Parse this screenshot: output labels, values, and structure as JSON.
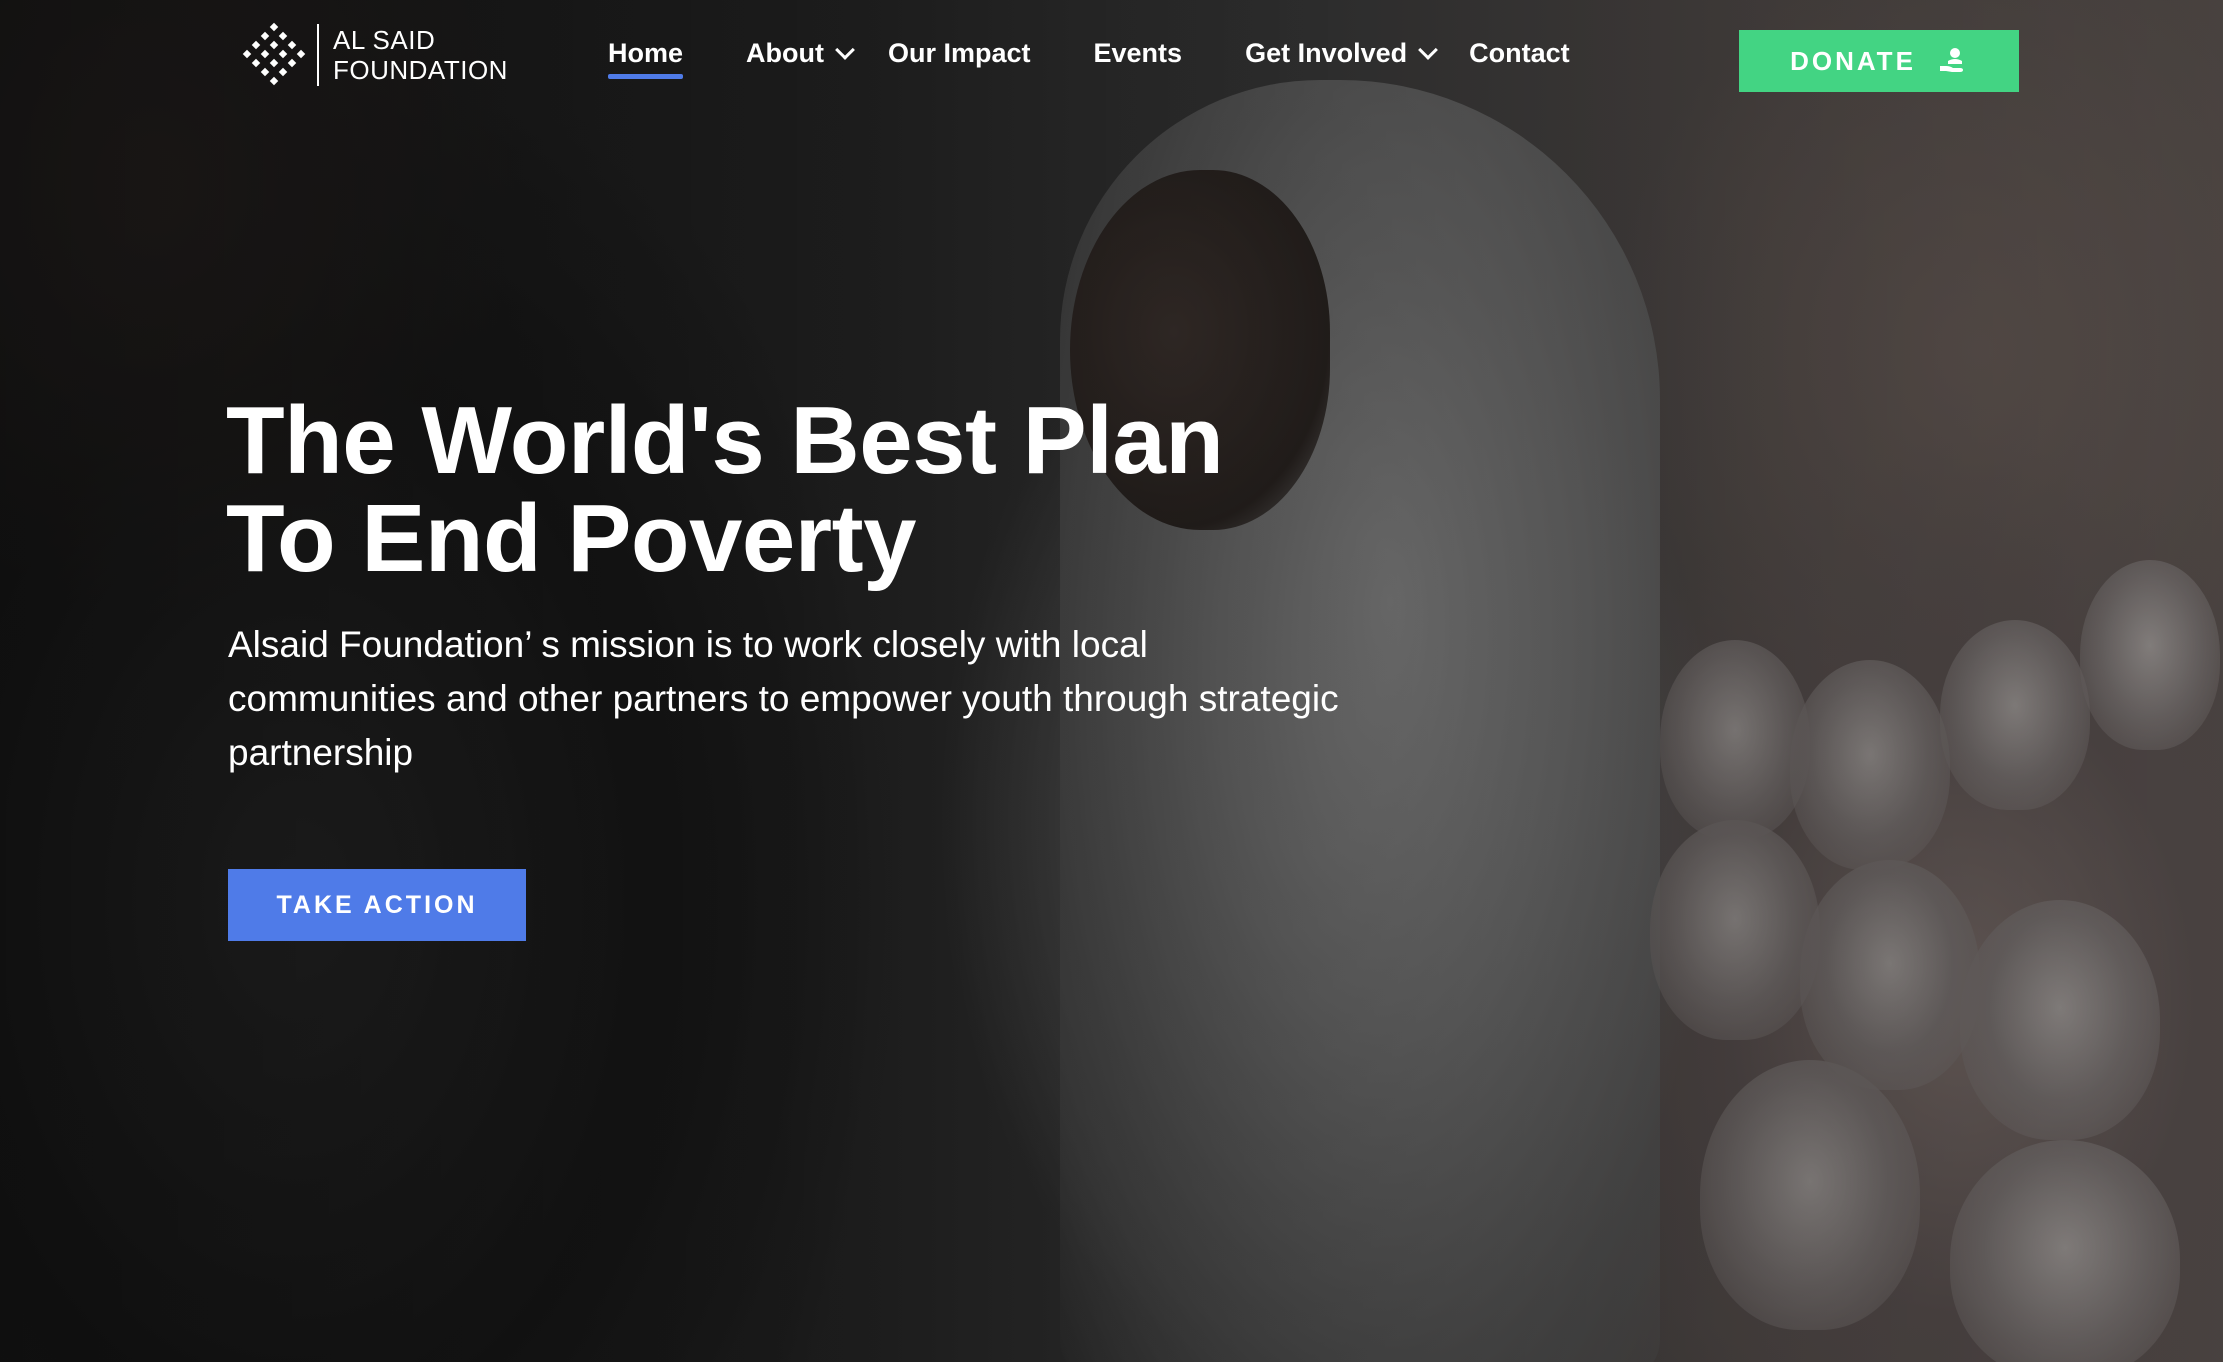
{
  "logo": {
    "line1": "AL SAID",
    "line2": "FOUNDATION",
    "icon": "diamond-dots-logo-icon"
  },
  "nav": {
    "items": [
      {
        "label": "Home",
        "active": true,
        "dropdown": false
      },
      {
        "label": "About",
        "active": false,
        "dropdown": true
      },
      {
        "label": "Our Impact",
        "active": false,
        "dropdown": false
      },
      {
        "label": "Events",
        "active": false,
        "dropdown": false
      },
      {
        "label": "Get Involved",
        "active": false,
        "dropdown": true
      },
      {
        "label": "Contact",
        "active": false,
        "dropdown": false
      }
    ],
    "active_color": "#4f7be8"
  },
  "donate": {
    "label": "DONATE",
    "icon": "donate-hand-person-icon",
    "color": "#43d483"
  },
  "hero": {
    "headline_line1": "The World's Best Plan",
    "headline_line2": "To End Poverty",
    "subtext": "Alsaid Foundation’ s mission is to work closely with local communities and other partners to empower youth through strategic partnership",
    "cta_label": "TAKE ACTION",
    "cta_color": "#4f7be8"
  }
}
